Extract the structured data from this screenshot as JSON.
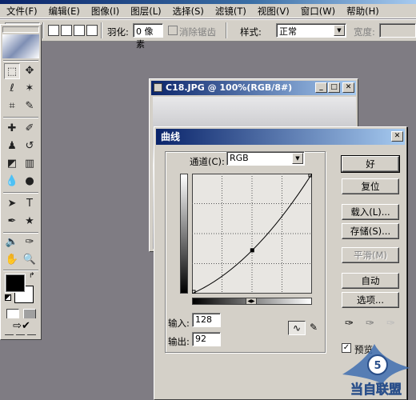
{
  "menubar": {
    "items": [
      "文件(F)",
      "编辑(E)",
      "图像(I)",
      "图层(L)",
      "选择(S)",
      "滤镜(T)",
      "视图(V)",
      "窗口(W)",
      "帮助(H)"
    ]
  },
  "options": {
    "feather_label": "羽化:",
    "feather_value": "0 像素",
    "antialias_label": "消除锯齿",
    "style_label": "样式:",
    "style_value": "正常",
    "width_label": "宽度:"
  },
  "image_window": {
    "title": "C18.JPG @ 100%(RGB/8#)"
  },
  "curves": {
    "title": "曲线",
    "channel_label": "通道(C):",
    "channel_value": "RGB",
    "input_label": "输入:",
    "input_value": "128",
    "output_label": "输出:",
    "output_value": "92",
    "buttons": {
      "ok": "好",
      "reset": "复位",
      "load": "载入(L)...",
      "save": "存储(S)...",
      "smooth": "平滑(M)",
      "auto": "自动",
      "options": "选项..."
    },
    "preview_label": "预览",
    "preview_checked": true,
    "curve_points": [
      [
        0,
        0
      ],
      [
        128,
        92
      ],
      [
        255,
        255
      ]
    ]
  },
  "watermark": {
    "text": "当自联盟"
  }
}
